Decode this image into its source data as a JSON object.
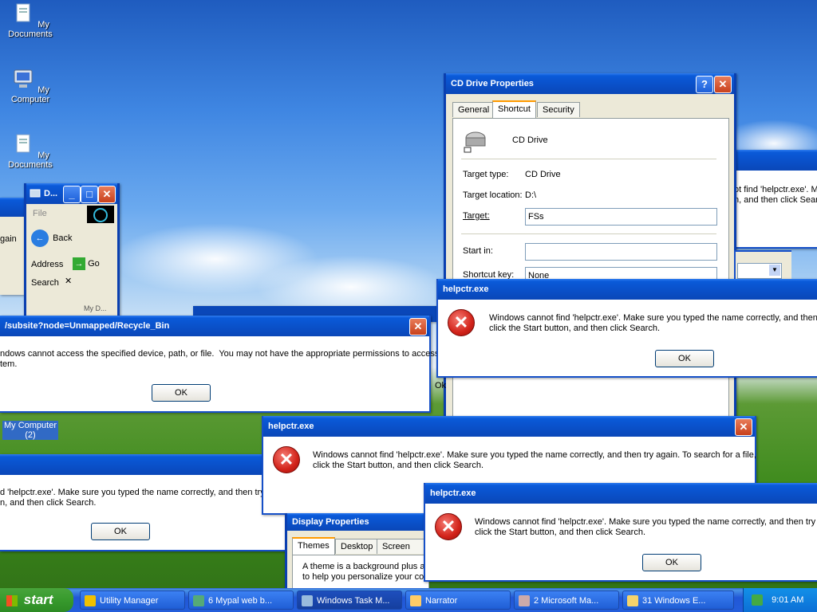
{
  "desktop": {
    "icons": [
      {
        "label": "My Documents",
        "icon": "documents-icon"
      },
      {
        "label": "My Computer",
        "icon": "computer-icon"
      },
      {
        "label": "My Documents",
        "icon": "documents-icon"
      },
      {
        "label": "My Computer\n(2)",
        "icon": "computer-icon"
      }
    ]
  },
  "explorer": {
    "title": "D...",
    "menu_file": "File",
    "back": "Back",
    "address": "Address",
    "go": "Go",
    "search": "Search",
    "item": "My D..."
  },
  "cd_props": {
    "title": "CD Drive Properties",
    "tabs": [
      "General",
      "Shortcut",
      "Security"
    ],
    "name": "CD Drive",
    "target_type_label": "Target type:",
    "target_type": "CD Drive",
    "target_location_label": "Target location:",
    "target_location": "D:\\",
    "target_label": "Target:",
    "target_value": "FSs",
    "start_in_label": "Start in:",
    "start_in_value": "",
    "shortcut_key_label": "Shortcut key:",
    "shortcut_key_value": "None",
    "ok_partial": "Ok"
  },
  "err_path": {
    "title": "/subsite?node=Unmapped/Recycle_Bin",
    "message": "ndows cannot access the specified device, path, or file.  You may not have the appropriate permissions to access\ntem.",
    "ok": "OK"
  },
  "err_left": {
    "message": "d 'helpctr.exe'. Make sure you typed the name correctly, and then try a\nn, and then click Search.",
    "ok": "OK",
    "partial": "gain"
  },
  "err_right_back": {
    "message": "ot find 'helpctr.exe'. M\nn, and then click Search."
  },
  "helpctr1": {
    "title": "helpctr.exe",
    "message": "Windows cannot find 'helpctr.exe'. Make sure you typed the name correctly, and then try\nclick the Start button, and then click Search.",
    "ok": "OK"
  },
  "helpctr2": {
    "title": "helpctr.exe",
    "message": "Windows cannot find 'helpctr.exe'. Make sure you typed the name correctly, and then try again. To search for a file,\nclick the Start button, and then click Search.",
    "ok": "OK"
  },
  "helpctr3": {
    "title": "helpctr.exe",
    "message": "Windows cannot find 'helpctr.exe'. Make sure you typed the name correctly, and then try a\nclick the Start button, and then click Search.",
    "ok": "OK"
  },
  "display_props": {
    "title": "Display Properties",
    "tabs": [
      "Themes",
      "Desktop",
      "Screen Sav"
    ],
    "text": "A theme is a background plus a\nto help you personalize your co"
  },
  "taskbar": {
    "start": "start",
    "tasks": [
      {
        "label": "Utility Manager",
        "active": false
      },
      {
        "label": "6 Mypal web b...",
        "active": false
      },
      {
        "label": "Windows Task M...",
        "active": true
      },
      {
        "label": "Narrator",
        "active": false
      },
      {
        "label": "2 Microsoft Ma...",
        "active": false
      },
      {
        "label": "31 Windows E...",
        "active": false
      }
    ],
    "clock": "9:01 AM"
  }
}
